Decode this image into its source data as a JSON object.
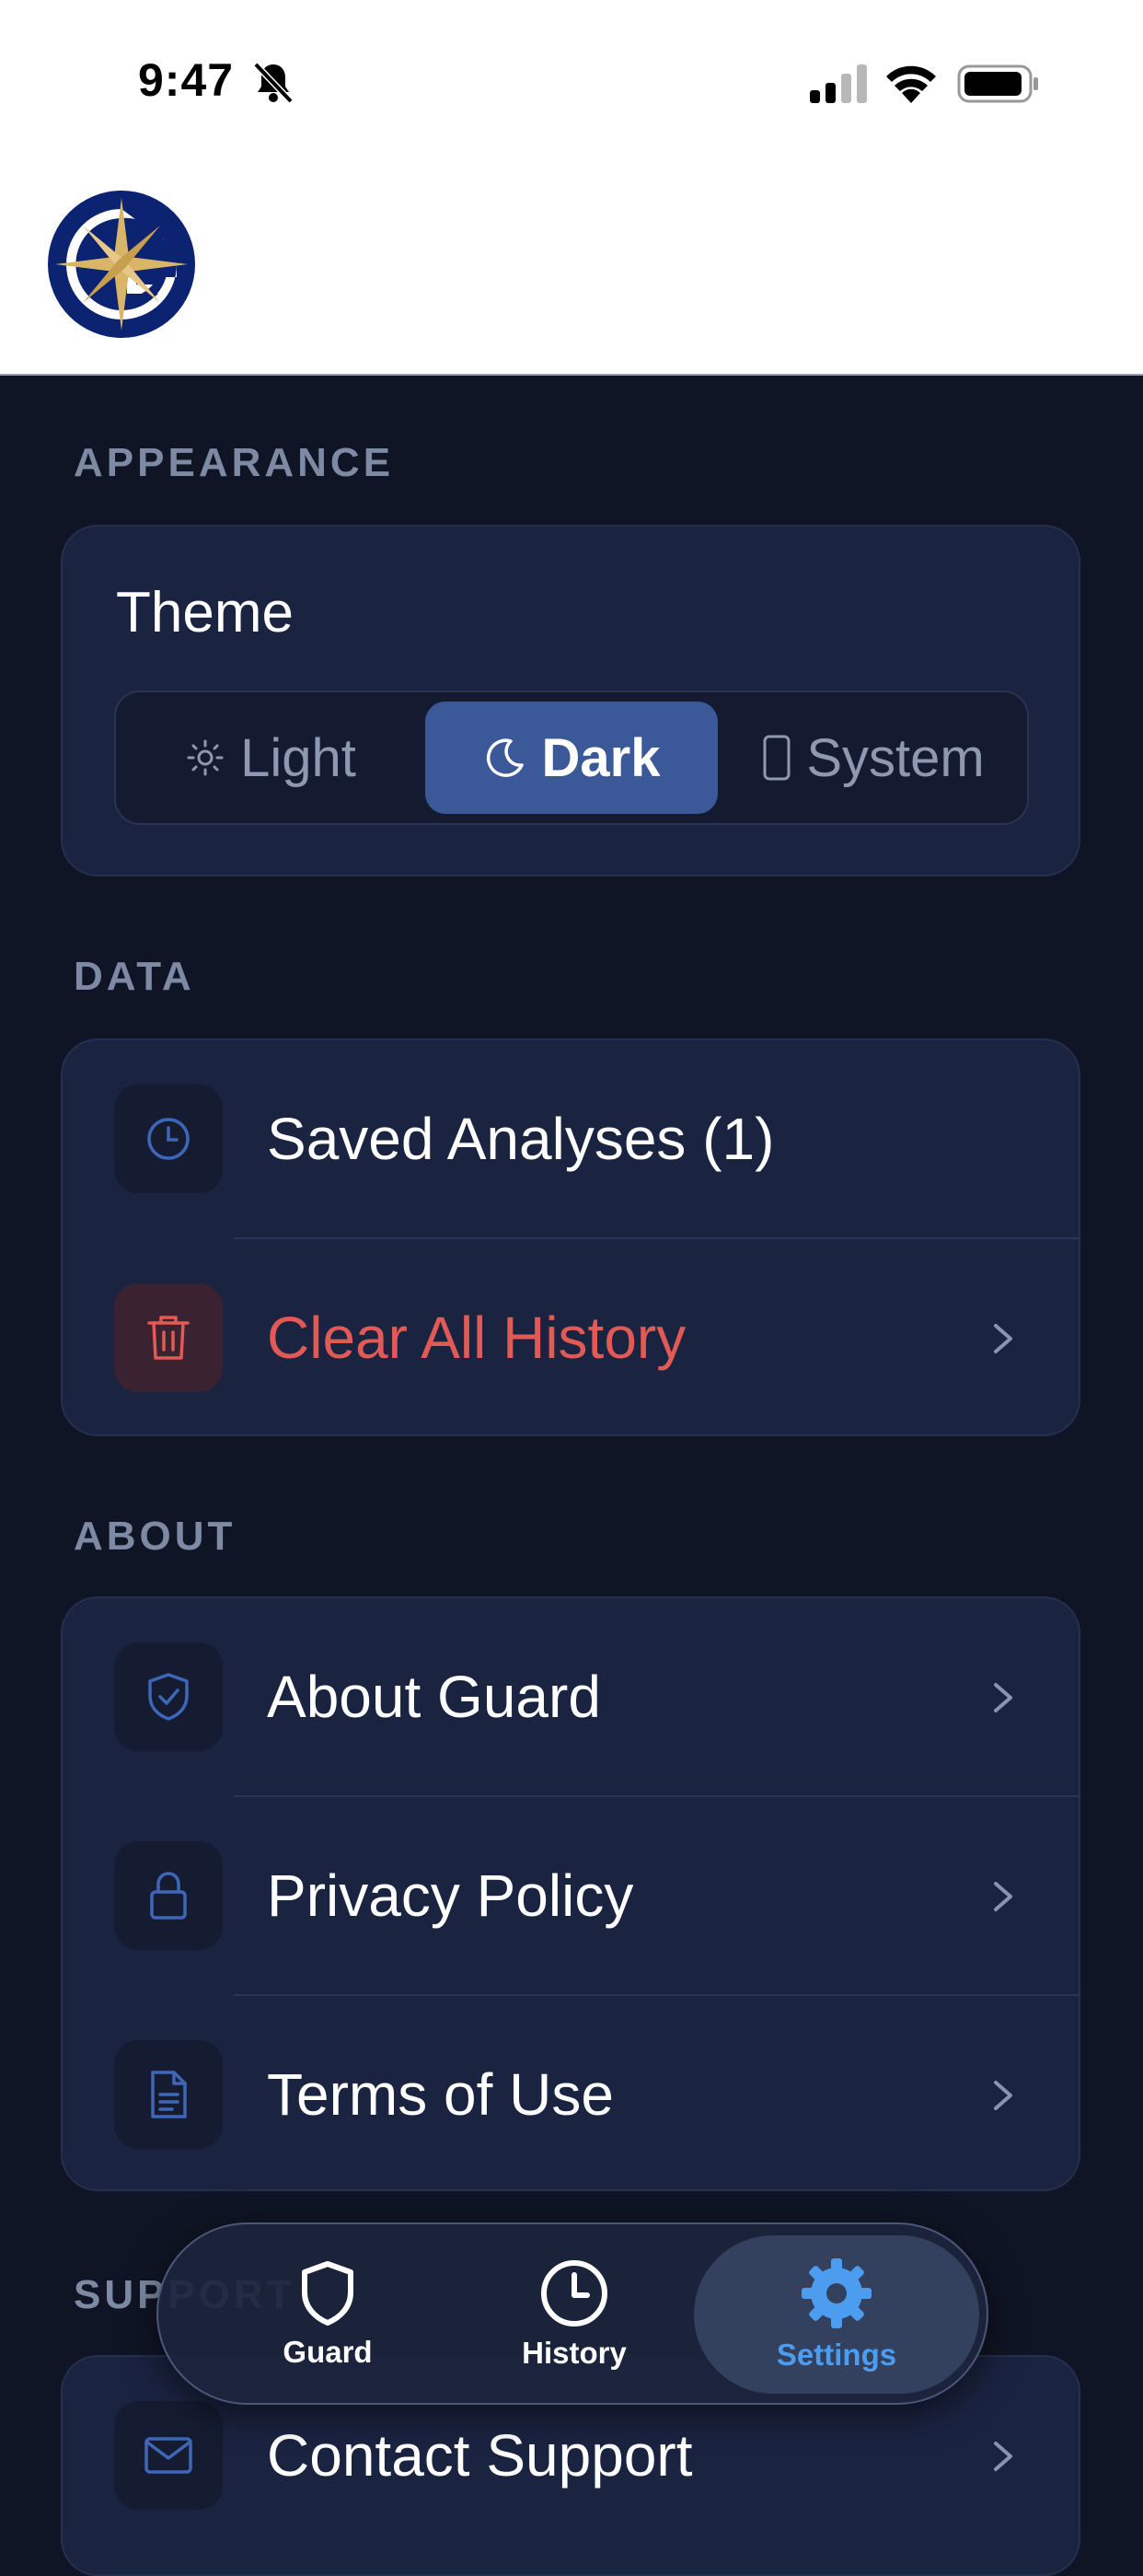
{
  "status_bar": {
    "time": "9:47",
    "icons": [
      "bell-slash-icon",
      "signal-icon",
      "wifi-icon",
      "battery-icon"
    ]
  },
  "header": {
    "logo": "g-compass-logo"
  },
  "sections": {
    "appearance": {
      "title": "APPEARANCE",
      "theme_label": "Theme",
      "options": [
        {
          "label": "Light",
          "icon": "sun-icon"
        },
        {
          "label": "Dark",
          "icon": "moon-icon"
        },
        {
          "label": "System",
          "icon": "phone-icon"
        }
      ],
      "selected": "Dark"
    },
    "data": {
      "title": "DATA",
      "items": [
        {
          "label": "Saved Analyses (1)",
          "icon": "clock-icon"
        },
        {
          "label": "Clear All History",
          "icon": "trash-icon"
        }
      ]
    },
    "about": {
      "title": "ABOUT",
      "items": [
        {
          "label": "About Guard",
          "icon": "shield-check-icon"
        },
        {
          "label": "Privacy Policy",
          "icon": "lock-icon"
        },
        {
          "label": "Terms of Use",
          "icon": "document-icon"
        }
      ]
    },
    "support": {
      "title": "SUPPORT",
      "items": [
        {
          "label": "Contact Support",
          "icon": "mail-icon"
        }
      ]
    }
  },
  "tab_bar": {
    "tabs": [
      {
        "label": "Guard",
        "icon": "shield-icon"
      },
      {
        "label": "History",
        "icon": "clock-icon"
      },
      {
        "label": "Settings",
        "icon": "gear-icon"
      }
    ],
    "active": "Settings"
  },
  "colors": {
    "background": "#0f1524",
    "card": "#1a2340",
    "accent": "#3b5998",
    "active_tab": "#4c9cf0",
    "danger": "#e25a55"
  }
}
